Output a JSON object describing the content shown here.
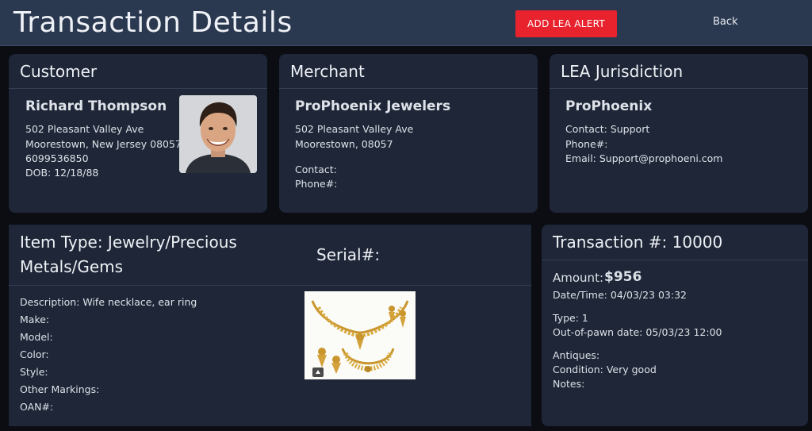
{
  "header": {
    "title": "Transaction Details",
    "alert_button": "ADD LEA ALERT",
    "back_label": "Back"
  },
  "customer": {
    "heading": "Customer",
    "name": "Richard Thompson",
    "address1": "502 Pleasant Valley Ave",
    "address2": "Moorestown, New Jersey 08057",
    "phone": "6099536850",
    "dob": "DOB: 12/18/88"
  },
  "merchant": {
    "heading": "Merchant",
    "name": "ProPhoenix Jewelers",
    "address1": "502 Pleasant Valley Ave",
    "address2": "Moorestown, 08057",
    "contact": "Contact:",
    "phone": "Phone#:"
  },
  "lea": {
    "heading": "LEA Jurisdiction",
    "name": "ProPhoenix",
    "contact": "Contact:  Support",
    "phone": "Phone#:",
    "email": "Email:  Support@prophoeni.com"
  },
  "item": {
    "type_line1": "Item Type:  Jewelry/Precious",
    "type_line2": "Metals/Gems",
    "serial": "Serial#:",
    "description": "Description: Wife necklace, ear ring",
    "make": "Make:",
    "model": "Model:",
    "color": "Color:",
    "style": "Style:",
    "other_markings": "Other Markings:",
    "oan": "OAN#:"
  },
  "transaction": {
    "heading": "Transaction #:  10000",
    "amount_label": "Amount:",
    "amount_value": "$956",
    "datetime": "Date/Time: 04/03/23 03:32",
    "type": "Type: 1",
    "out_of_pawn": "Out-of-pawn date: 05/03/23 12:00",
    "antiques": "Antiques:",
    "condition": "Condition: Very good",
    "notes": "Notes:"
  },
  "colors": {
    "accent_red": "#e8232e",
    "header_bg": "#2a3850",
    "card_bg": "#1e2637"
  }
}
